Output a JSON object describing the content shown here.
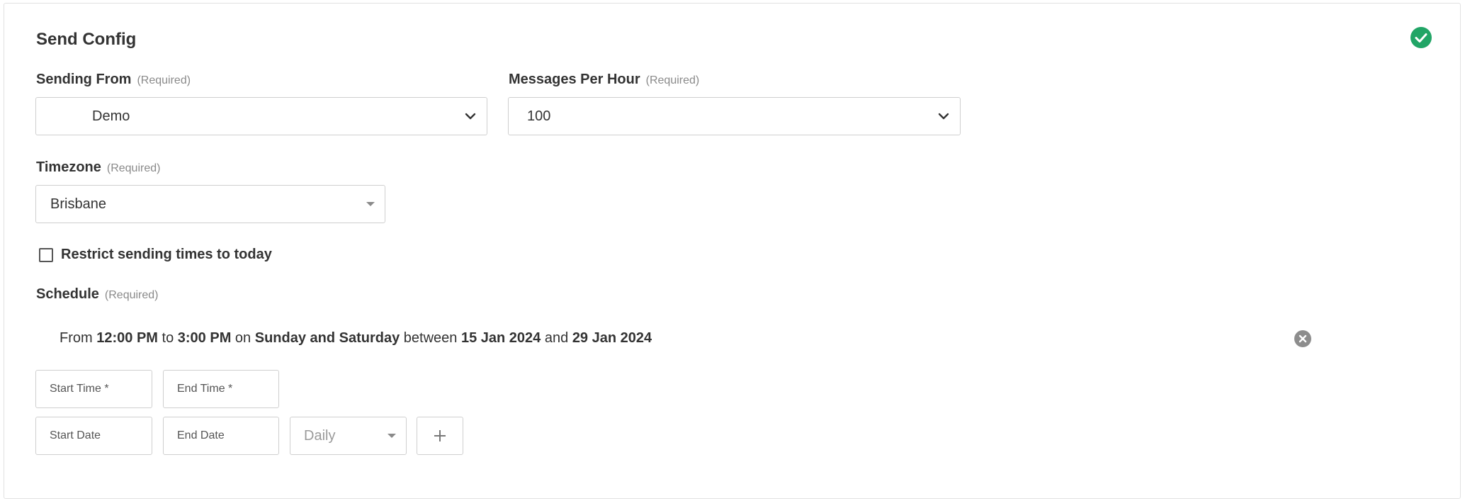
{
  "card": {
    "title": "Send Config",
    "status_icon": "check-circle-icon",
    "status_color": "#21a566"
  },
  "sending_from": {
    "label": "Sending From",
    "required": "(Required)",
    "value": "Demo",
    "icon": "chevron-down-icon"
  },
  "messages_per_hour": {
    "label": "Messages Per Hour",
    "required": "(Required)",
    "value": "100",
    "icon": "chevron-down-icon"
  },
  "timezone": {
    "label": "Timezone",
    "required": "(Required)",
    "value": "Brisbane",
    "icon": "caret-down-icon"
  },
  "restrict": {
    "label": "Restrict sending times to today",
    "checked": false
  },
  "schedule": {
    "label": "Schedule",
    "required": "(Required)",
    "entry": {
      "from_word": "From",
      "start_time": "12:00 PM",
      "to_word": "to",
      "end_time": "3:00 PM",
      "on_word": "on",
      "days": "Sunday and Saturday",
      "between_word": "between",
      "start_date": "15 Jan 2024",
      "and_word": "and",
      "end_date": "29 Jan 2024",
      "remove_icon": "clear-circle-icon"
    },
    "start_time_placeholder": "Start Time *",
    "end_time_placeholder": "End Time *",
    "start_date_placeholder": "Start Date",
    "end_date_placeholder": "End Date",
    "frequency": "Daily",
    "add_icon": "plus-icon"
  }
}
